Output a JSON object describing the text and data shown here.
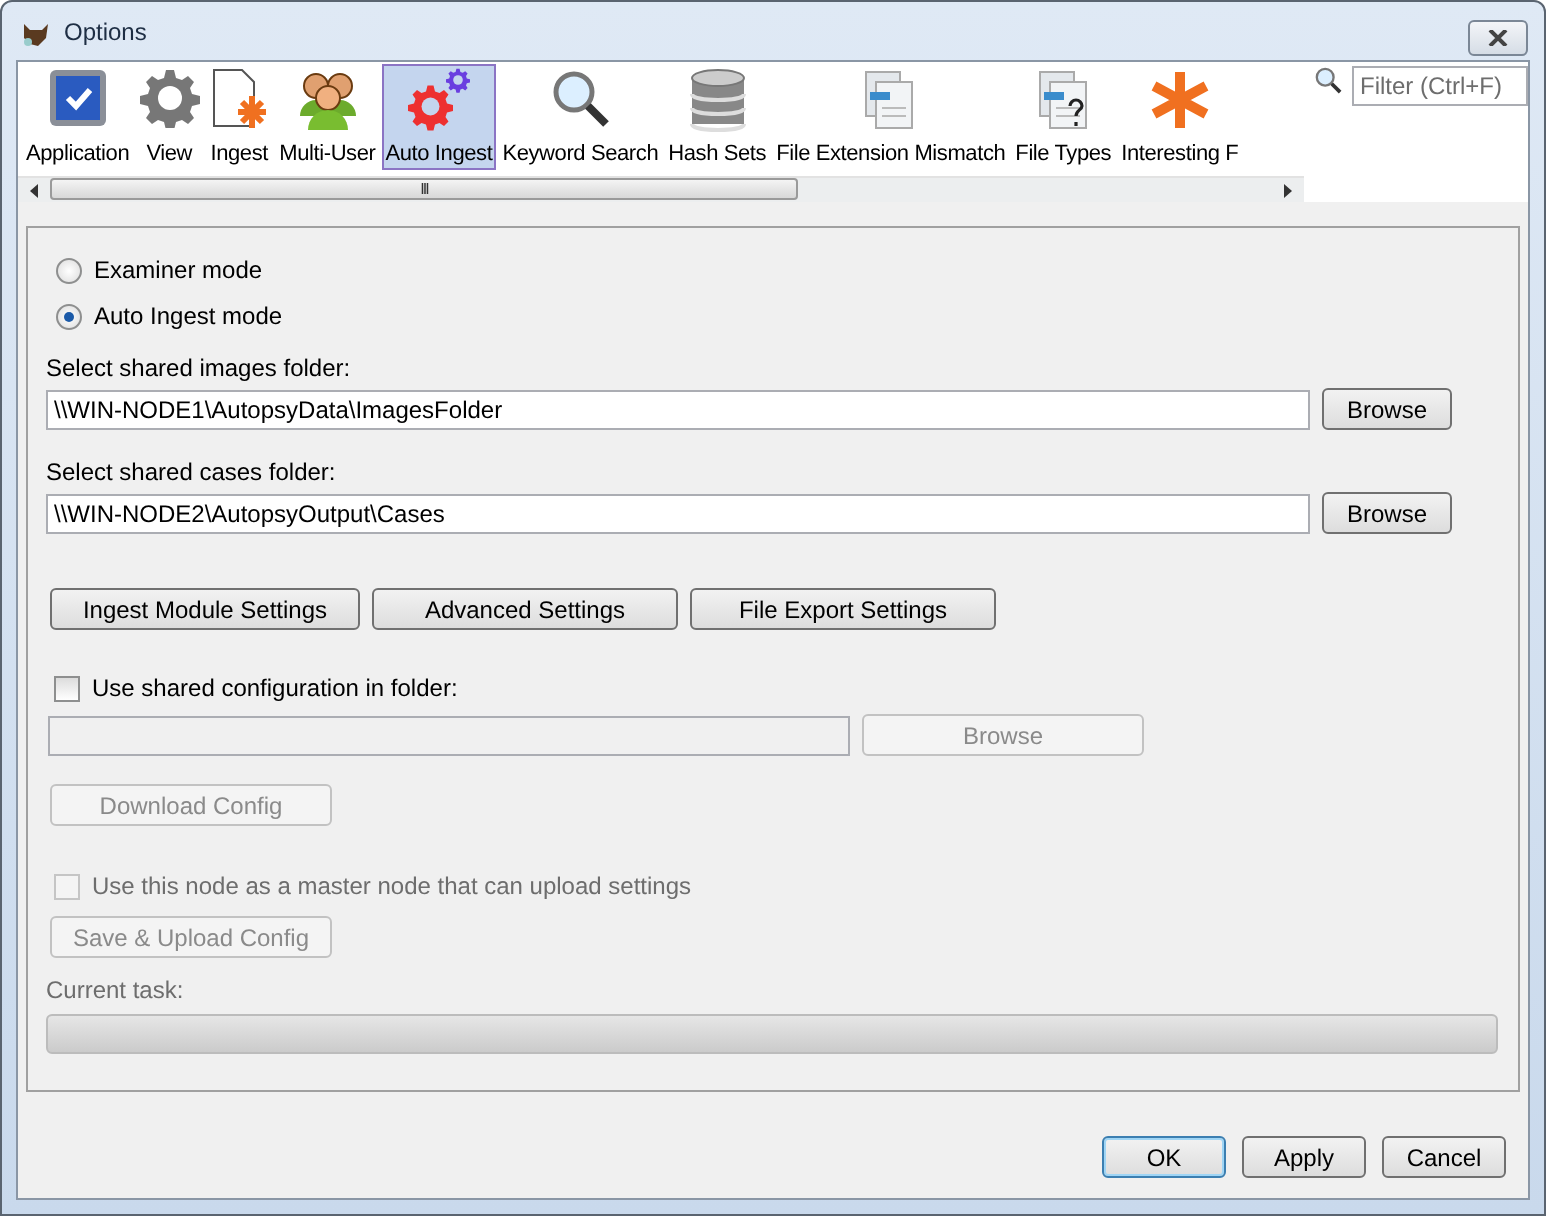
{
  "window": {
    "title": "Options"
  },
  "toolbar": {
    "items": [
      {
        "label": "Application",
        "selected": false
      },
      {
        "label": "View",
        "selected": false
      },
      {
        "label": "Ingest",
        "selected": false
      },
      {
        "label": "Multi-User",
        "selected": false
      },
      {
        "label": "Auto Ingest",
        "selected": true
      },
      {
        "label": "Keyword Search",
        "selected": false
      },
      {
        "label": "Hash Sets",
        "selected": false
      },
      {
        "label": "File Extension Mismatch",
        "selected": false
      },
      {
        "label": "File Types",
        "selected": false
      },
      {
        "label": "Interesting F",
        "selected": false
      }
    ],
    "scroll_grip": "III",
    "filter_placeholder": "Filter (Ctrl+F)"
  },
  "mode_options": [
    {
      "label": "Examiner mode",
      "selected": false
    },
    {
      "label": "Auto Ingest mode",
      "selected": true
    }
  ],
  "folder_fields": [
    {
      "label": "Select shared images folder:",
      "value": "\\\\WIN-NODE1\\AutopsyData\\ImagesFolder",
      "button": "Browse"
    },
    {
      "label": "Select shared cases folder:",
      "value": "\\\\WIN-NODE2\\AutopsyOutput\\Cases",
      "button": "Browse"
    }
  ],
  "settings_buttons": [
    "Ingest Module Settings",
    "Advanced Settings",
    "File Export Settings"
  ],
  "shared_config": {
    "label": "Use shared configuration in folder:",
    "checked": false,
    "controls_disabled": true,
    "browse": "Browse",
    "download": "Download Config"
  },
  "master_node": {
    "label": "Use this node as a master node that can upload settings",
    "checked": false,
    "disabled": true,
    "button": "Save & Upload Config"
  },
  "current_task": {
    "label": "Current task:",
    "level": 0
  },
  "dialog_buttons": [
    {
      "label": "OK",
      "default": true
    },
    {
      "label": "Apply",
      "default": false
    },
    {
      "label": "Cancel",
      "default": false
    }
  ]
}
